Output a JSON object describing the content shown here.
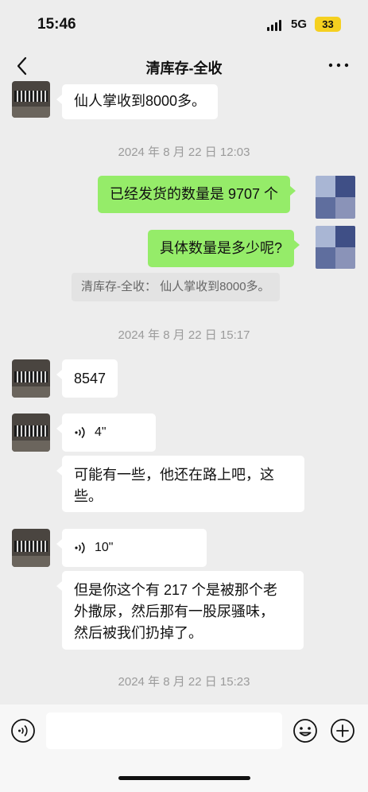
{
  "status_bar": {
    "time": "15:46",
    "network": "5G",
    "battery": "33"
  },
  "nav": {
    "title": "清库存-全收"
  },
  "messages": [
    {
      "text": "仙人掌收到8000多。"
    },
    {
      "timestamp": "2024 年 8 月 22 日 12:03"
    },
    {
      "text": "已经发货的数量是 9707 个"
    },
    {
      "text": "具体数量是多少呢?"
    },
    {
      "quote": "清库存-全收： 仙人掌收到8000多。"
    },
    {
      "timestamp": "2024 年 8 月 22 日 15:17"
    },
    {
      "text": "8547"
    },
    {
      "voice_duration": "4\""
    },
    {
      "text_lines": [
        "可能有一些，他还在路上吧，这",
        "些。"
      ]
    },
    {
      "voice_duration": "10\""
    },
    {
      "text_lines": [
        "但是你这个有 217 个是被那个老",
        "外撒尿，然后那有一股尿骚味，",
        "然后被我们扔掉了。"
      ]
    },
    {
      "timestamp": "2024 年 8 月 22 日 15:23"
    }
  ]
}
